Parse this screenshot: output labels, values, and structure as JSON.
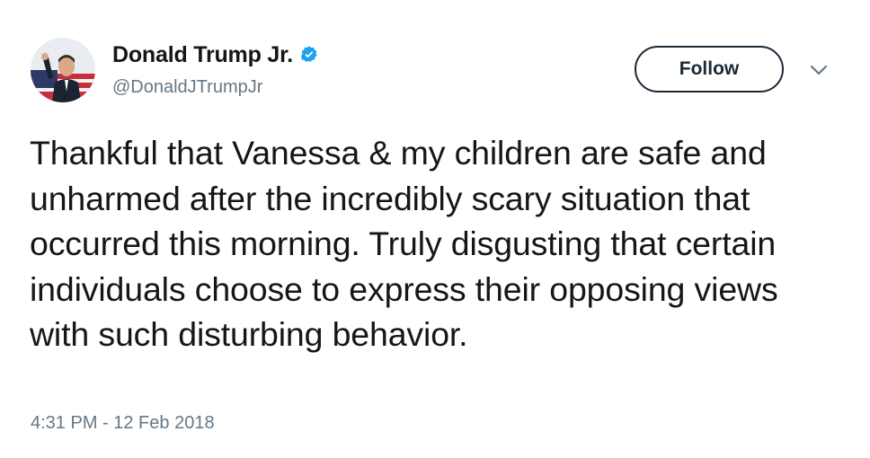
{
  "tweet": {
    "author": {
      "display_name": "Donald Trump Jr.",
      "handle": "@DonaldJTrumpJr",
      "verified": true,
      "avatar_icon": "profile-photo"
    },
    "follow_button_label": "Follow",
    "menu_icon": "chevron-down-icon",
    "text": "Thankful that Vanessa & my children are safe and unharmed after the incredibly scary situation that occurred this morning. Truly disgusting that certain individuals choose to express their opposing views with such disturbing behavior.",
    "timestamp": "4:31 PM - 12 Feb 2018"
  },
  "colors": {
    "text_primary": "#14171a",
    "text_secondary": "#657786",
    "verified_blue": "#1da1f2",
    "follow_outline": "#1b2836"
  }
}
